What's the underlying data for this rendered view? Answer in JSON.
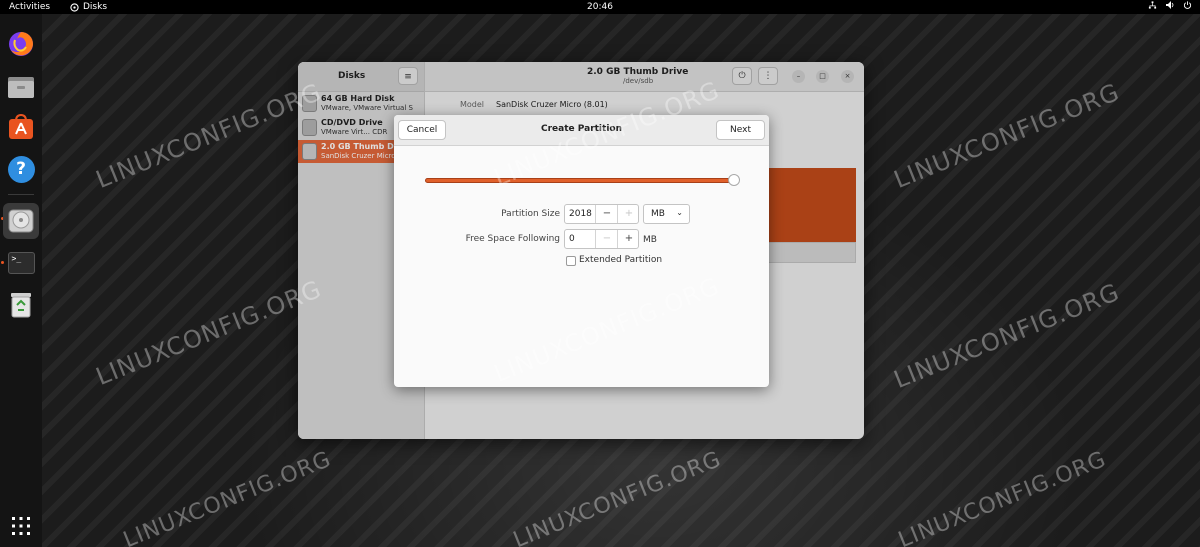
{
  "topbar": {
    "activities": "Activities",
    "app_name": "Disks",
    "clock": "20:46"
  },
  "dock": {
    "items": [
      {
        "name": "Firefox",
        "icon": "firefox-icon"
      },
      {
        "name": "Files",
        "icon": "files-icon"
      },
      {
        "name": "Ubuntu Software",
        "icon": "software-icon"
      },
      {
        "name": "Help",
        "icon": "help-icon"
      },
      {
        "name": "Disks",
        "icon": "disks-icon"
      },
      {
        "name": "Terminal",
        "icon": "terminal-icon"
      },
      {
        "name": "Trash",
        "icon": "trash-icon"
      }
    ],
    "help_glyph": "?",
    "terminal_glyph": ">_"
  },
  "disks": {
    "sidebar_title": "Disks",
    "drives": [
      {
        "name": "64 GB Hard Disk",
        "sub": "VMware, VMware Virtual S"
      },
      {
        "name": "CD/DVD Drive",
        "sub": "VMware Virt...   CDR"
      },
      {
        "name": "2.0 GB Thumb Drive",
        "sub": "SanDisk Cruzer Micro"
      }
    ],
    "selected_drive": 2,
    "title": "2.0 GB Thumb Drive",
    "subtitle": "/dev/sdb",
    "model_label": "Model",
    "model_value": "SanDisk Cruzer Micro (8.01)"
  },
  "dialog": {
    "title": "Create Partition",
    "cancel": "Cancel",
    "next": "Next",
    "partition_size_label": "Partition Size",
    "partition_size_value": "2018",
    "unit": "MB",
    "free_space_label": "Free Space Following",
    "free_space_value": "0",
    "free_space_unit": "MB",
    "extended_label": "Extended Partition",
    "extended_checked": false,
    "slider_fraction": 1.0
  },
  "watermark": "LINUXCONFIG.ORG",
  "colors": {
    "accent": "#e95420",
    "selected_row": "#e2683c",
    "partition_fill": "#c24a1a"
  }
}
